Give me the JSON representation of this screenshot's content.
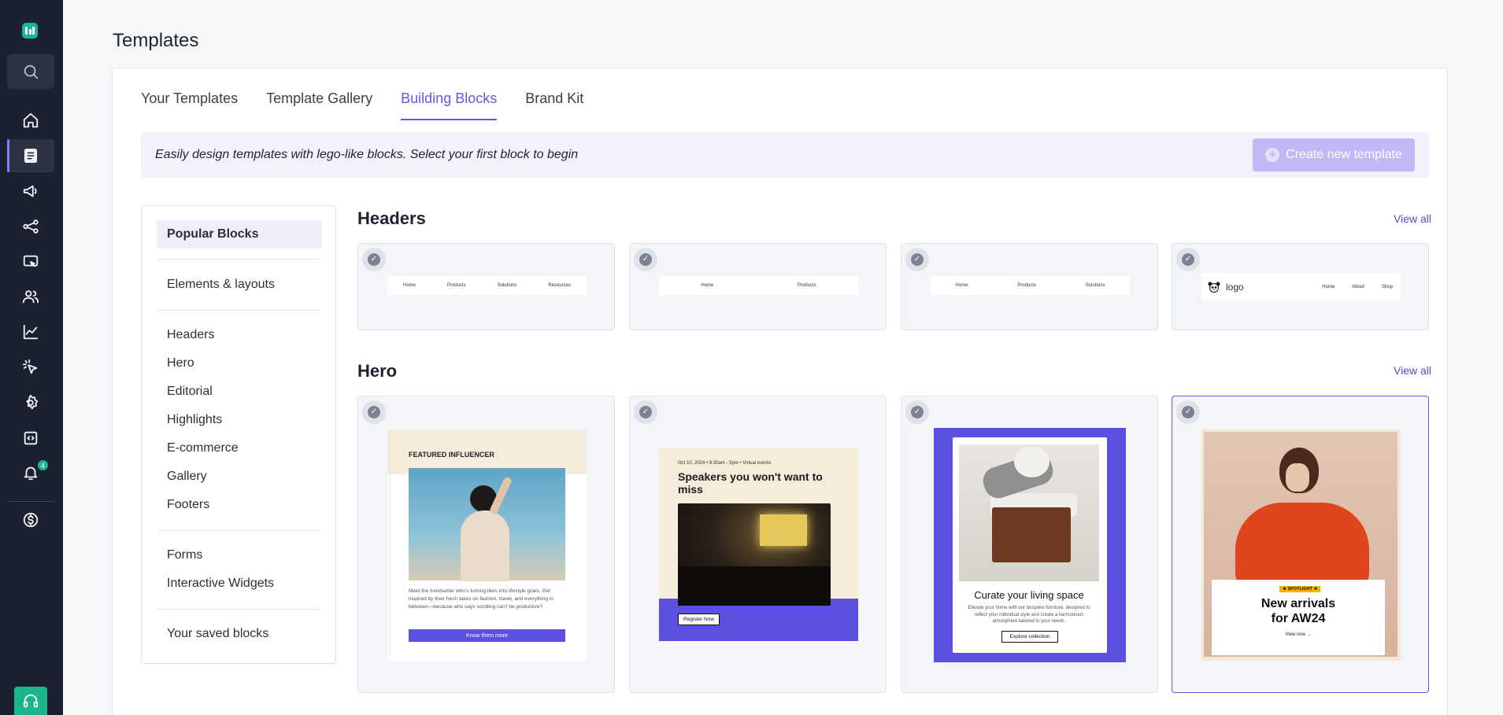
{
  "page": {
    "title": "Templates"
  },
  "tabs": [
    {
      "label": "Your Templates"
    },
    {
      "label": "Template Gallery"
    },
    {
      "label": "Building Blocks"
    },
    {
      "label": "Brand Kit"
    }
  ],
  "banner": {
    "text": "Easily design templates with lego-like blocks. Select your first block to begin",
    "button_label": "Create new template"
  },
  "filters": {
    "popular": "Popular Blocks",
    "elements": "Elements & layouts",
    "categories": [
      "Headers",
      "Hero",
      "Editorial",
      "Highlights",
      "E-commerce",
      "Gallery",
      "Footers"
    ],
    "forms": "Forms",
    "widgets": "Interactive Widgets",
    "saved": "Your saved blocks"
  },
  "sections": {
    "headers": {
      "title": "Headers",
      "view_all": "View all",
      "tiles": [
        {
          "links": [
            "Home",
            "Products",
            "Solutions",
            "Resources"
          ]
        },
        {
          "links": [
            "Home",
            "Products"
          ]
        },
        {
          "links": [
            "Home",
            "Products",
            "Solutions"
          ]
        },
        {
          "logo": "logo",
          "links": [
            "Home",
            "About",
            "Shop"
          ]
        }
      ]
    },
    "hero": {
      "title": "Hero",
      "view_all": "View all",
      "tiles": [
        {
          "kicker": "FEATURED INFLUENCER",
          "body": "Meet the trendsetter who's turning likes into lifestyle goals. Get inspired by their fresh takes on fashion, travel, and everything in between—because who says scrolling can't be productive?",
          "cta": "Know them more"
        },
        {
          "meta": "Oct 10, 2024  •  9:30am - 5pm  •  Virtual events",
          "headline": "Speakers you won't want to miss",
          "cta": "Register Now"
        },
        {
          "headline": "Curate your living space",
          "body": "Elevate your home with our bespoke furniture, designed to reflect your individual style and create a harmonious atmosphere tailored to your needs.",
          "cta": "Explore collection"
        },
        {
          "tag": "SPOTLIGHT",
          "headline_1": "New arrivals",
          "headline_2": "for AW24",
          "cta": "View now →"
        }
      ]
    }
  },
  "rail": {
    "notification_count": "4"
  },
  "colors": {
    "accent": "#6a55e3",
    "rail": "#1b2131",
    "brand": "#19b69a"
  }
}
